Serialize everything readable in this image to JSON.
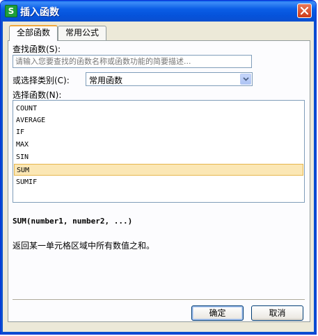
{
  "window": {
    "title": "插入函数",
    "app_icon_letter": "S"
  },
  "tabs": [
    {
      "label": "全部函数",
      "active": true
    },
    {
      "label": "常用公式",
      "active": false
    }
  ],
  "search": {
    "label": "查找函数(S):",
    "placeholder": "请输入您要查找的函数名称或函数功能的简要描述..."
  },
  "category": {
    "label": "或选择类别(C):",
    "selected": "常用函数"
  },
  "function_list": {
    "label": "选择函数(N):",
    "items": [
      "COUNT",
      "AVERAGE",
      "IF",
      "MAX",
      "SIN",
      "SUM",
      "SUMIF"
    ],
    "selected": "SUM"
  },
  "details": {
    "signature": "SUM(number1, number2, ...)",
    "description": "返回某一单元格区域中所有数值之和。"
  },
  "buttons": {
    "ok": "确定",
    "cancel": "取消"
  },
  "colors": {
    "title_bar": "#0553db",
    "selection": "#fbe7b5",
    "tab_highlight": "#f1a83b"
  }
}
